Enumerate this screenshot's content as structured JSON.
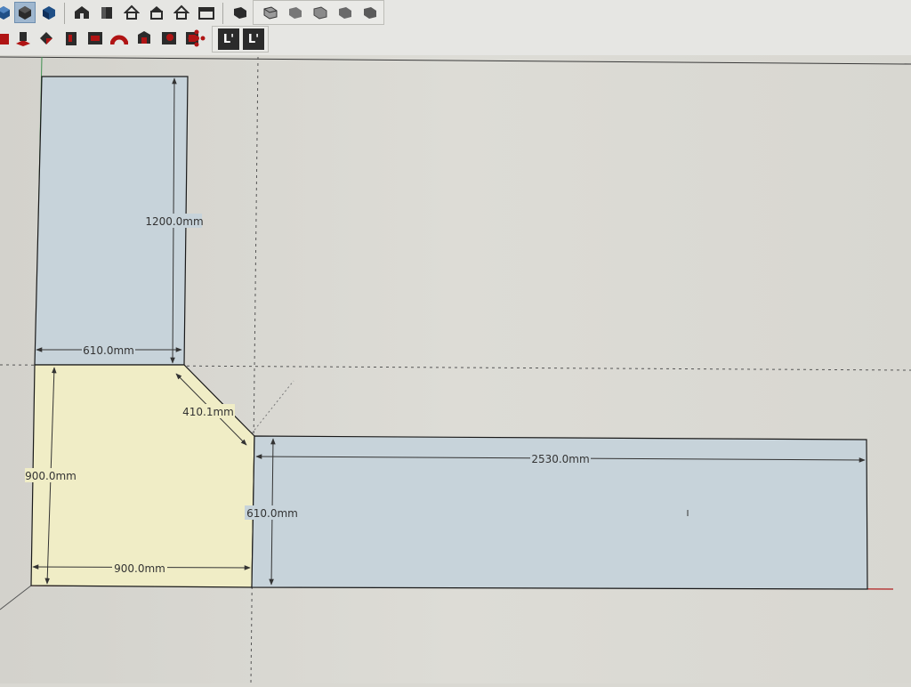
{
  "toolbar": {
    "row1": [
      {
        "icon": "blue-cube-icon",
        "active": false
      },
      {
        "icon": "view-cube-icon",
        "active": true
      },
      {
        "icon": "blue-cube-icon",
        "active": false
      },
      {
        "icon": "iso-house-icon",
        "active": false
      },
      {
        "icon": "front-view-icon",
        "active": false
      },
      {
        "icon": "home-icon",
        "active": false
      },
      {
        "icon": "back-view-icon",
        "active": false
      },
      {
        "icon": "left-view-icon",
        "active": false
      },
      {
        "icon": "garage-icon",
        "active": false
      },
      {
        "icon": "solid-style-icon",
        "active": false
      },
      {
        "icon": "wireframe-style-icon",
        "active": false
      },
      {
        "icon": "hidden-line-style-icon",
        "active": false
      },
      {
        "icon": "shaded-style-icon",
        "active": false
      },
      {
        "icon": "textured-style-icon",
        "active": false
      },
      {
        "icon": "monochrome-style-icon",
        "active": false
      }
    ],
    "row2": [
      {
        "icon": "paint-tool-icon"
      },
      {
        "icon": "push-pull-icon"
      },
      {
        "icon": "follow-me-icon"
      },
      {
        "icon": "section-box-icon"
      },
      {
        "icon": "sandbox-icon"
      },
      {
        "icon": "arc-tool-icon"
      },
      {
        "icon": "rotate-icon"
      },
      {
        "icon": "orbit-icon"
      },
      {
        "icon": "components-icon"
      },
      {
        "icon": "explode-icon"
      },
      {
        "icon": "layer-l-icon"
      },
      {
        "icon": "layer-l-icon"
      }
    ],
    "layer_label": "L'",
    "colors": {
      "active_bg": "#9fb7cf",
      "icon_dark": "#2b2b2b",
      "icon_blue": "#1f4f86",
      "icon_red": "#b01414"
    }
  },
  "drawing": {
    "dimensions": {
      "top_height": "1200.0mm",
      "top_width": "610.0mm",
      "diagonal": "410.1mm",
      "corner_height": "900.0mm",
      "corner_width": "900.0mm",
      "right_length": "2530.0mm",
      "right_depth": "610.0mm"
    },
    "colors": {
      "panel_blue": "#c7d3da",
      "corner_yellow": "#f0edc6",
      "edge": "#1a1a1a",
      "dimension": "#333333",
      "red_axis": "#b02020",
      "green_axis": "#3f8f4f"
    }
  }
}
